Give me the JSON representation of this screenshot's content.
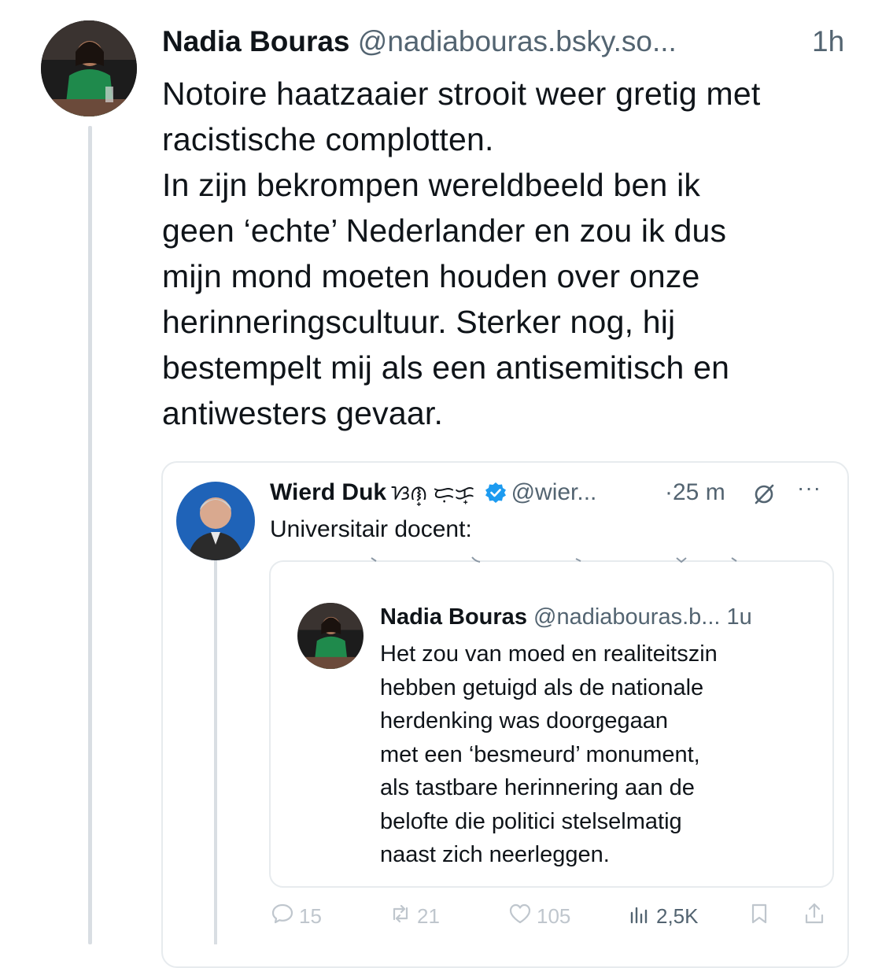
{
  "post": {
    "author_name": "Nadia Bouras",
    "handle": "@nadiabouras.bsky.so...",
    "time": "1h",
    "body_lines": [
      "Notoire haatzaaier strooit weer gretig met",
      "racistische complotten.",
      "In zijn bekrompen wereldbeeld ben ik",
      "geen ‘echte’ Nederlander en zou ik dus",
      "mijn mond moeten houden over onze",
      "herinneringscultuur. Sterker nog, hij",
      "bestempelt mij als een antisemitisch en",
      "antiwesters gevaar."
    ]
  },
  "quoted": {
    "author_name": "Wierd Duk",
    "name_glyphs": "ᜐᜈ᜔ ᜇᜓᜃ᜔",
    "handle": "@wier...",
    "time": "·25 m",
    "more": "···",
    "text": "Universitair docent:",
    "inner": {
      "author_name": "Nadia Bouras",
      "handle": "@nadiabouras.b...",
      "time": "1u",
      "body_lines": [
        "Het zou van moed en realiteitszin",
        "hebben getuigd als de nationale",
        "herdenking was doorgegaan",
        "met een ‘besmeurd’ monument,",
        "als tastbare herinnering aan de",
        "belofte die politici stelselmatig",
        "naast zich neerleggen."
      ]
    },
    "actions": {
      "replies": "15",
      "reposts": "21",
      "likes": "105",
      "views": "2,5K"
    }
  },
  "icons": {
    "verified": "verified-badge-icon",
    "refresh": "refresh-icon",
    "reply": "reply-icon",
    "repost": "repost-icon",
    "like": "like-icon",
    "views": "views-icon",
    "bookmark": "bookmark-icon",
    "share": "share-icon"
  },
  "colors": {
    "text": "#0f1419",
    "muted": "#536471",
    "verified": "#1d9bf0",
    "border": "#e7ebee"
  }
}
